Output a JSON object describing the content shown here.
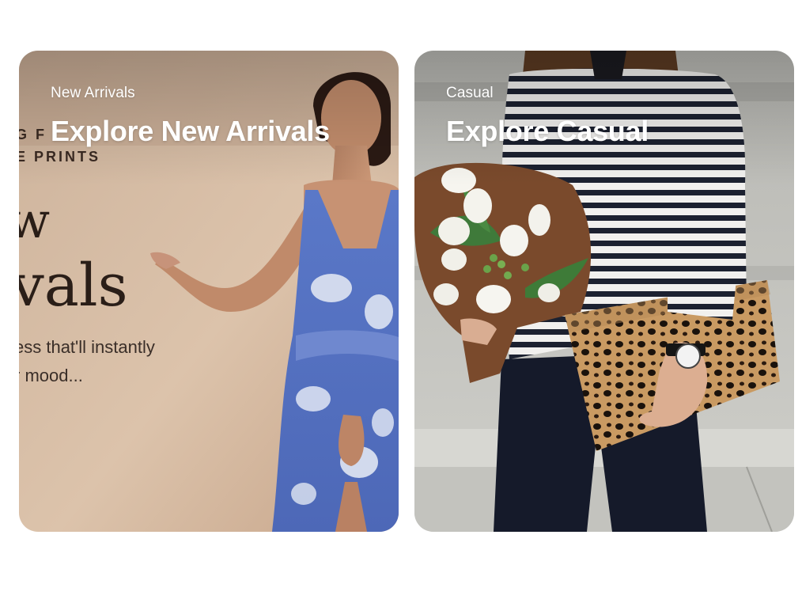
{
  "cards": [
    {
      "category": "New Arrivals",
      "title": "Explore New Arrivals",
      "image": "woman-in-blue-floral-slip-dress"
    },
    {
      "category": "Casual",
      "title": "Explore Casual",
      "image": "striped-top-with-tulip-bouquet-and-leopard-clutch"
    }
  ],
  "colors": {
    "text": "#ffffff",
    "background": "#ffffff"
  }
}
